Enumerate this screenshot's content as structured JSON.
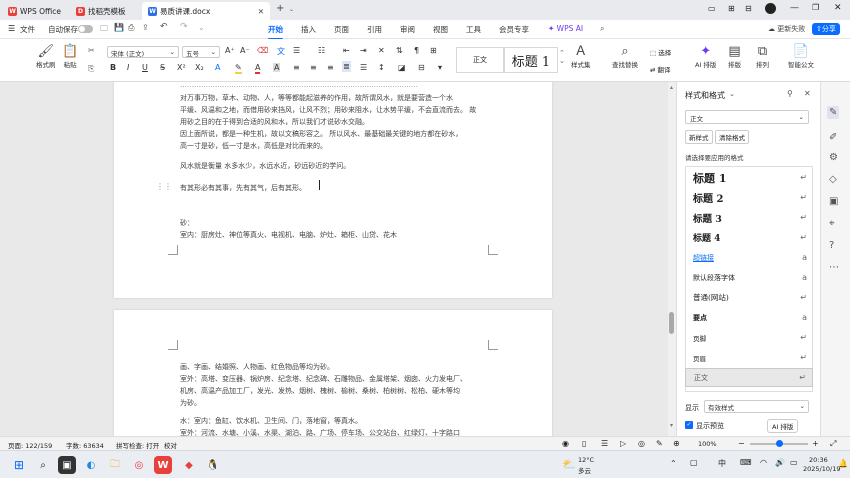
{
  "titlebar": {
    "tabs": [
      {
        "label": "WPS Office",
        "icon": "wps-logo-icon",
        "color": "#e8403a"
      },
      {
        "label": "找稻壳模板",
        "icon": "docer-icon",
        "color": "#e8403a"
      },
      {
        "label": "易质讲课.docx",
        "icon": "writer-doc-icon",
        "color": "#2b6fe6"
      }
    ],
    "new_tab": "+"
  },
  "menubar": {
    "file_label": "文件",
    "autosave_label": "自动保存",
    "items": [
      "开始",
      "插入",
      "页面",
      "引用",
      "审阅",
      "视图",
      "工具",
      "会员专享"
    ],
    "wps_ai": "WPS AI",
    "update_label": "更新失败",
    "share_label": "分享"
  },
  "ribbon": {
    "format_painter": "格式刷",
    "paste": "粘贴",
    "font_name": "宋体 (正文)",
    "font_size": "五号",
    "style_normal": "正文",
    "style_heading1": "标题 1",
    "styles_set": "样式集",
    "find_replace": "查找替换",
    "select": "选择",
    "translate": "翻译",
    "ai_layout": "AI 排版",
    "layout": "排版",
    "arrange": "排列",
    "smart_doc": "智能公文"
  },
  "document": {
    "page1_lines": [
      "…………………………………………………………………………………………",
      "对万事万物，草木、动物、人，等等都能起滋养的作用，故所谓风水，就是要营造一个水",
      "平缓、风温和之地，而借用砂来挡风，让风不烈；用砂来阻水，让水势平缓，不会直流而去。  故",
      "用砂之目的在于得到合适的风和水，所以我们才说砂水交融。",
      "因上面所说，都是一种生机，故以文稿形容之。  所以风水、最基础最关键的地方都在砂水，",
      "高一寸是砂，低一寸是水，高低是对比而来的。",
      "风水就是衡量 水多水少，水远水近，砂远砂近的学问。",
      "有其形必有其事，先有其气，后有其形。",
      "砂：",
      "室内：厨房灶、神位等真火、电视机、电脑、炉灶、箱柜、山贷、花木"
    ],
    "page2_lines": [
      "画、字画、结婚照、人物画、红色物品等均为砂。",
      "室外：高塔、变压器、锅炉房、纪念塔、纪念碑、石雕物品、金属塔架、烟囱、火力发电厂、",
      "机房、高温产品加工厂，发光、发热、烟树、槐树、榆树、桑树、柏树树、松柏、硬木等均",
      "为砂。",
      "水：室内：鱼缸、饮水机、卫生间、门，落地窗，等真水。",
      "室外：河流、水塘、小溪、水渠、湖泊、路、广场、停车场、公交站台、红绿灯、十字路口"
    ]
  },
  "panel": {
    "title": "样式和格式",
    "current_style": "正文",
    "new_style": "新样式",
    "clear_format": "清除格式",
    "apply_hint": "请选择要应用的格式",
    "styles": [
      "标题 1",
      "标题 2",
      "标题 3",
      "标题 4",
      "超链接",
      "默认段落字体",
      "普通(网站)",
      "要点",
      "页脚",
      "页眉",
      "正文"
    ],
    "show_label": "显示",
    "show_value": "有效样式",
    "preview_label": "显示预览",
    "ai_layout": "AI 排版"
  },
  "statusbar": {
    "page": "页面: 122/159",
    "words": "字数: 63634",
    "spell": "拼写检查: 打开",
    "proof": "校对",
    "zoom": "100%"
  },
  "taskbar": {
    "weather_temp": "12°C",
    "weather_desc": "多云",
    "ime": "中",
    "time": "20:36",
    "date": "2025/10/19"
  },
  "colors": {
    "accent": "#0a6cff",
    "wps_red": "#e8403a"
  }
}
